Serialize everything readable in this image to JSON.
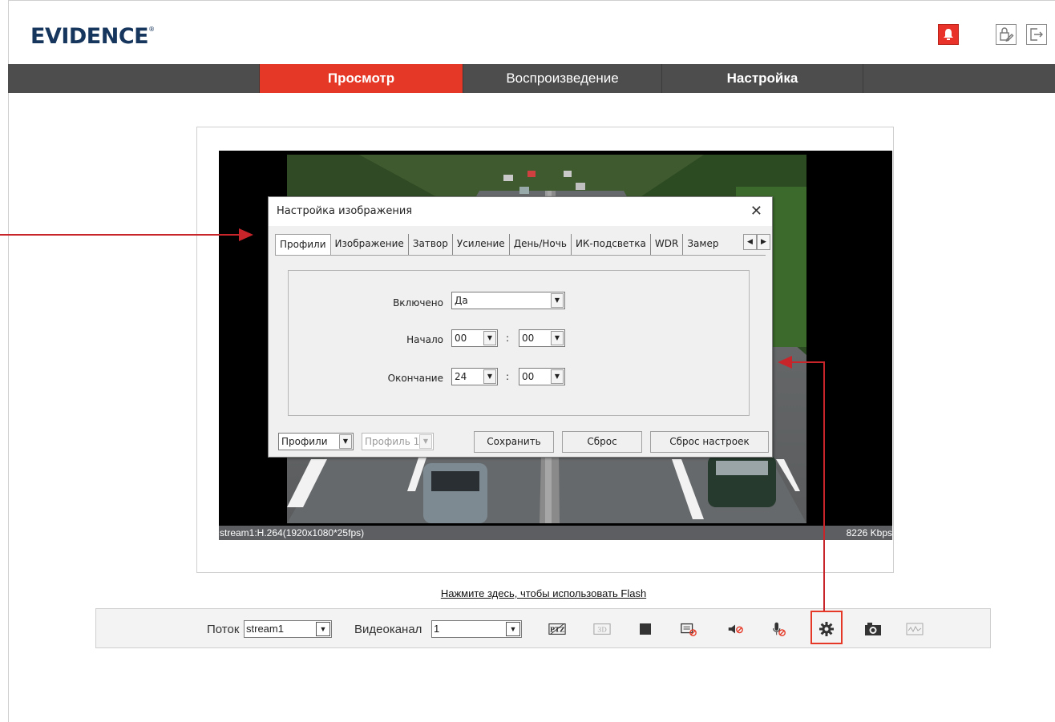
{
  "header": {
    "logo_text": "EVIDENCE",
    "logo_mark": "®",
    "icons": [
      "alarm-icon",
      "lock-edit-icon",
      "logout-icon"
    ]
  },
  "nav": {
    "tabs": [
      {
        "label": "Просмотр",
        "active": true
      },
      {
        "label": "Воспроизведение",
        "active": false
      },
      {
        "label": "Настройка",
        "active": false
      }
    ]
  },
  "video": {
    "stream_info": "stream1:H.264(1920x1080*25fps)",
    "bitrate": "8226 Kbps"
  },
  "dialog": {
    "title": "Настройка изображения",
    "tabs": [
      "Профили",
      "Изображение",
      "Затвор",
      "Усиление",
      "День/Ночь",
      "ИК-подсветка",
      "WDR",
      "Замер"
    ],
    "active_tab": "Профили",
    "fields": {
      "enabled_label": "Включено",
      "enabled_value": "Да",
      "start_label": "Начало",
      "start_hour": "00",
      "start_min": "00",
      "end_label": "Окончание",
      "end_hour": "24",
      "end_min": "00",
      "colon": ":"
    },
    "bottom": {
      "profile_type": "Профили",
      "profile_select": "Профиль 1",
      "save_label": "Сохранить",
      "reset_label": "Сброс",
      "defaults_label": "Сброс настроек"
    }
  },
  "flash_link": "Нажмите здесь, чтобы использовать Flash",
  "toolbar": {
    "stream_label": "Поток",
    "stream_value": "stream1",
    "channel_label": "Видеоканал",
    "channel_value": "1",
    "ptz_label": "PTZ",
    "three_d_label": "3D"
  },
  "colors": {
    "accent": "#e53826",
    "navbar": "#4d4d4d",
    "logo": "#17365d",
    "annotation": "#c8252b"
  }
}
